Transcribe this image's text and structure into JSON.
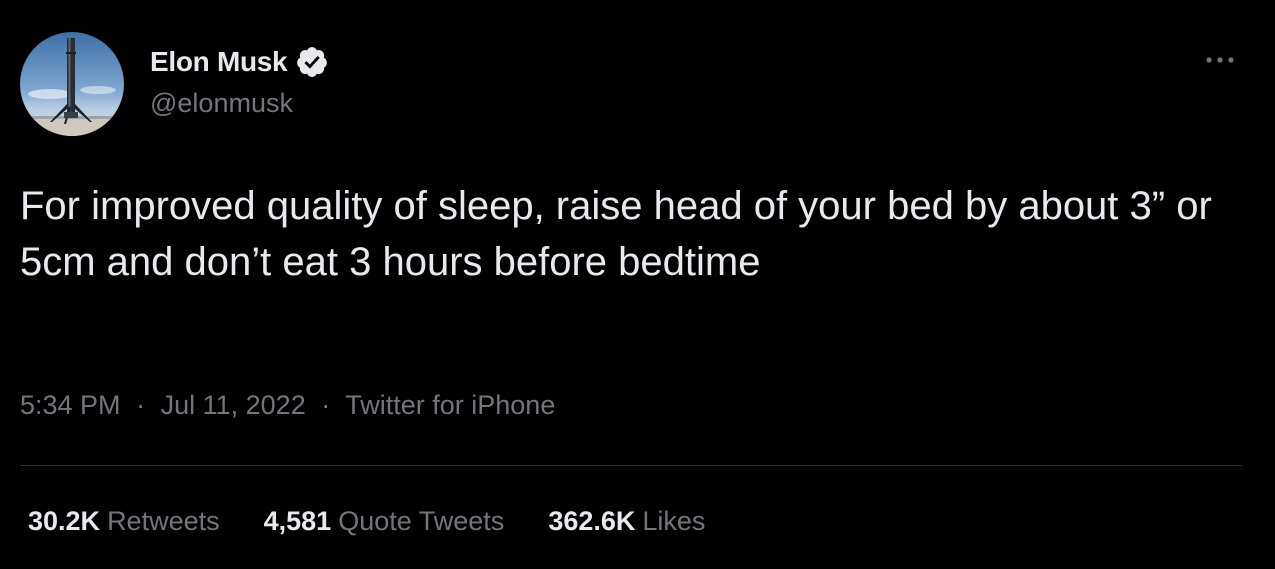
{
  "author": {
    "display_name": "Elon Musk",
    "handle": "@elonmusk",
    "verified": true,
    "avatar_icon": "rocket-landing-photo"
  },
  "tweet": {
    "text": "For improved quality of sleep, raise head of your bed by about 3” or 5cm and don’t eat 3 hours before bedtime"
  },
  "meta": {
    "time": "5:34 PM",
    "separator": "·",
    "date": "Jul 11, 2022",
    "source": "Twitter for iPhone"
  },
  "stats": {
    "retweets": {
      "count": "30.2K",
      "label": "Retweets"
    },
    "quote_tweets": {
      "count": "4,581",
      "label": "Quote Tweets"
    },
    "likes": {
      "count": "362.6K",
      "label": "Likes"
    }
  },
  "icons": {
    "verified": "verified-badge-icon",
    "more": "more-options-icon"
  },
  "colors": {
    "background": "#000000",
    "primary_text": "#e7e9ea",
    "secondary_text": "#71767b",
    "divider": "#2f3336",
    "verified_badge": "#e7e9ea"
  }
}
